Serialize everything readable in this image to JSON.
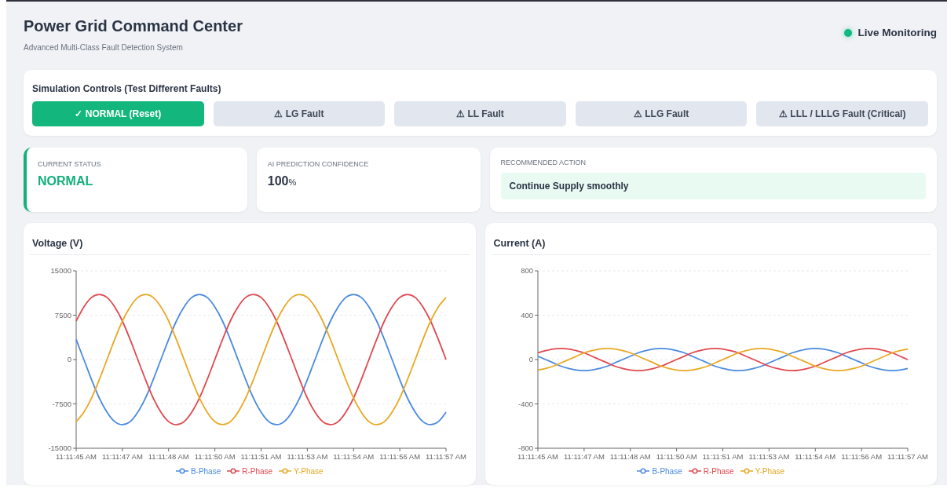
{
  "header": {
    "title": "Power Grid Command Center",
    "subtitle": "Advanced Multi-Class Fault Detection System",
    "live": {
      "label": "Live Monitoring",
      "on": true
    }
  },
  "controls": {
    "title": "Simulation Controls (Test Different Faults)",
    "buttons": [
      {
        "label": "✓ NORMAL (Reset)",
        "selected": true
      },
      {
        "label": "⚠ LG Fault",
        "selected": false
      },
      {
        "label": "⚠ LL Fault",
        "selected": false
      },
      {
        "label": "⚠ LLG Fault",
        "selected": false
      },
      {
        "label": "⚠ LLL / LLLG Fault (Critical)",
        "selected": false
      }
    ]
  },
  "status": {
    "label": "CURRENT STATUS",
    "value": "NORMAL"
  },
  "confidence": {
    "label": "AI PREDICTION CONFIDENCE",
    "value": "100",
    "unit": "%"
  },
  "action": {
    "label": "RECOMMENDED ACTION",
    "text": "Continue Supply smoothly"
  },
  "charts": [
    {
      "title": "Voltage (V)",
      "chart_data": {
        "type": "line",
        "grid": true,
        "ylim": [
          -15000,
          15000
        ],
        "yticks": [
          -15000,
          -7500,
          0,
          7500,
          15000
        ],
        "categories": [
          "11:11:45 AM",
          null,
          null,
          null,
          null,
          null,
          "11:11:47 AM",
          null,
          null,
          null,
          null,
          null,
          "11:11:48 AM",
          null,
          null,
          null,
          null,
          null,
          "11:11:50 AM",
          null,
          null,
          null,
          null,
          null,
          "11:11:51 AM",
          null,
          null,
          null,
          null,
          null,
          "11:11:53 AM",
          null,
          null,
          null,
          null,
          null,
          "11:11:54 AM",
          null,
          null,
          null,
          null,
          null,
          "11:11:56 AM",
          null,
          null,
          null,
          null,
          null,
          "11:11:57 AM"
        ],
        "series": [
          {
            "name": "B-Phase",
            "color": "#4a8ae0",
            "values": [
              3400,
              0,
              -3400,
              -6500,
              -8900,
              -10500,
              -11000,
              -10500,
              -8900,
              -6500,
              -3400,
              0,
              3400,
              6500,
              8900,
              10500,
              11000,
              10500,
              8900,
              6500,
              3400,
              0,
              -3400,
              -6500,
              -8900,
              -10500,
              -11000,
              -10500,
              -8900,
              -6500,
              -3400,
              0,
              3400,
              6500,
              8900,
              10500,
              11000,
              10500,
              8900,
              6500,
              3400,
              0,
              -3400,
              -6500,
              -8900,
              -10500,
              -11000,
              -10500,
              -8900
            ]
          },
          {
            "name": "R-Phase",
            "color": "#e0484f",
            "values": [
              6500,
              8900,
              10500,
              11000,
              10500,
              8900,
              6500,
              3400,
              0,
              -3400,
              -6500,
              -8900,
              -10500,
              -11000,
              -10500,
              -8900,
              -6500,
              -3400,
              0,
              3400,
              6500,
              8900,
              10500,
              11000,
              10500,
              8900,
              6500,
              3400,
              0,
              -3400,
              -6500,
              -8900,
              -10500,
              -11000,
              -10500,
              -8900,
              -6500,
              -3400,
              0,
              3400,
              6500,
              8900,
              10500,
              11000,
              10500,
              8900,
              6500,
              3400,
              0
            ]
          },
          {
            "name": "Y-Phase",
            "color": "#e8a824",
            "values": [
              -10500,
              -8900,
              -6500,
              -3400,
              0,
              3400,
              6500,
              8900,
              10500,
              11000,
              10500,
              8900,
              6500,
              3400,
              0,
              -3400,
              -6500,
              -8900,
              -10500,
              -11000,
              -10500,
              -8900,
              -6500,
              -3400,
              0,
              3400,
              6500,
              8900,
              10500,
              11000,
              10500,
              8900,
              6500,
              3400,
              0,
              -3400,
              -6500,
              -8900,
              -10500,
              -11000,
              -10500,
              -8900,
              -6500,
              -3400,
              0,
              3400,
              6500,
              8900,
              10500
            ]
          }
        ]
      }
    },
    {
      "title": "Current (A)",
      "chart_data": {
        "type": "line",
        "grid": true,
        "ylim": [
          -800,
          800
        ],
        "yticks": [
          -800,
          -400,
          0,
          400,
          800
        ],
        "categories": [
          "11:11:45 AM",
          null,
          null,
          null,
          null,
          null,
          "11:11:47 AM",
          null,
          null,
          null,
          null,
          null,
          "11:11:48 AM",
          null,
          null,
          null,
          null,
          null,
          "11:11:50 AM",
          null,
          null,
          null,
          null,
          null,
          "11:11:51 AM",
          null,
          null,
          null,
          null,
          null,
          "11:11:53 AM",
          null,
          null,
          null,
          null,
          null,
          "11:11:54 AM",
          null,
          null,
          null,
          null,
          null,
          "11:11:56 AM",
          null,
          null,
          null,
          null,
          null,
          "11:11:57 AM"
        ],
        "series": [
          {
            "name": "B-Phase",
            "color": "#4a8ae0",
            "values": [
              30,
              0,
              -30,
              -60,
              -80,
              -95,
              -100,
              -95,
              -80,
              -60,
              -30,
              0,
              30,
              60,
              80,
              95,
              100,
              95,
              80,
              60,
              30,
              0,
              -30,
              -60,
              -80,
              -95,
              -100,
              -95,
              -80,
              -60,
              -30,
              0,
              30,
              60,
              80,
              95,
              100,
              95,
              80,
              60,
              30,
              0,
              -30,
              -60,
              -80,
              -95,
              -100,
              -95,
              -80
            ]
          },
          {
            "name": "R-Phase",
            "color": "#e0484f",
            "values": [
              60,
              80,
              95,
              100,
              95,
              80,
              60,
              30,
              0,
              -30,
              -60,
              -80,
              -95,
              -100,
              -95,
              -80,
              -60,
              -30,
              0,
              30,
              60,
              80,
              95,
              100,
              95,
              80,
              60,
              30,
              0,
              -30,
              -60,
              -80,
              -95,
              -100,
              -95,
              -80,
              -60,
              -30,
              0,
              30,
              60,
              80,
              95,
              100,
              95,
              80,
              60,
              30,
              0
            ]
          },
          {
            "name": "Y-Phase",
            "color": "#e8a824",
            "values": [
              -95,
              -80,
              -60,
              -30,
              0,
              30,
              60,
              80,
              95,
              100,
              95,
              80,
              60,
              30,
              0,
              -30,
              -60,
              -80,
              -95,
              -100,
              -95,
              -80,
              -60,
              -30,
              0,
              30,
              60,
              80,
              95,
              100,
              95,
              80,
              60,
              30,
              0,
              -30,
              -60,
              -80,
              -95,
              -100,
              -95,
              -80,
              -60,
              -30,
              0,
              30,
              60,
              80,
              95
            ]
          }
        ]
      }
    }
  ]
}
